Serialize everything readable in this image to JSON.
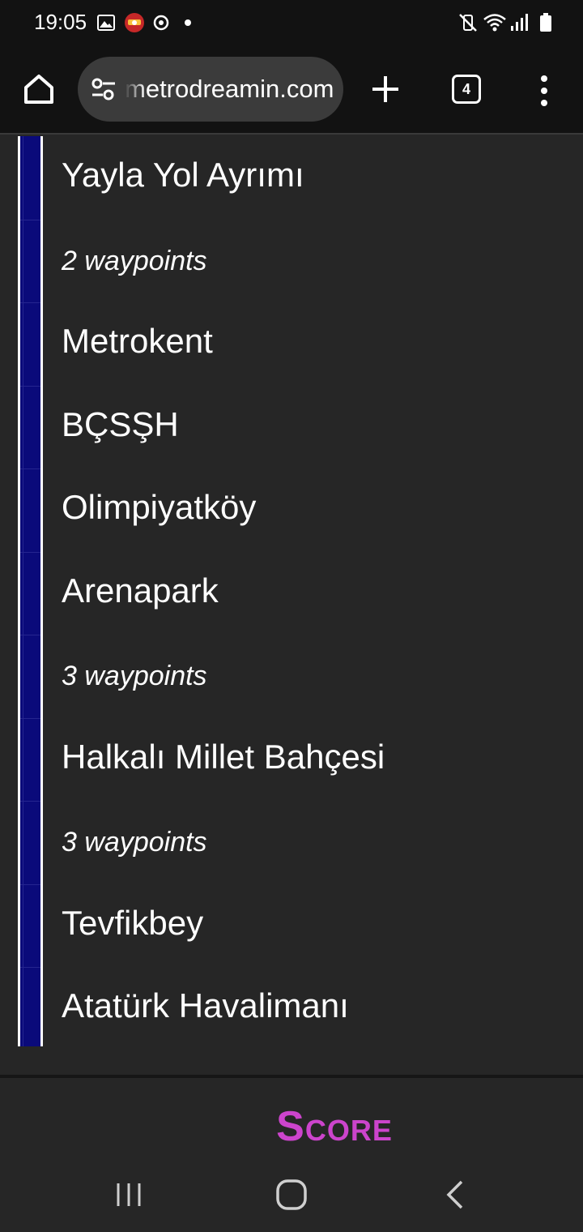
{
  "status_bar": {
    "time": "19:05",
    "left_icons": [
      "image-icon",
      "app-badge-icon",
      "sync-icon",
      "dot-icon"
    ],
    "right_icons": [
      "mute-vibrate-icon",
      "wifi-icon",
      "signal-icon",
      "battery-icon"
    ]
  },
  "browser": {
    "url": "metrodreamin.com",
    "tab_count": "4",
    "icons": [
      "home-icon",
      "site-settings-icon",
      "plus-icon",
      "more-vert-icon"
    ]
  },
  "line": {
    "color": "#0a0a7a",
    "stops": [
      {
        "label": "Yayla Yol Ayrımı",
        "waypoint": false
      },
      {
        "label": "2 waypoints",
        "waypoint": true
      },
      {
        "label": "Metrokent",
        "waypoint": false
      },
      {
        "label": "BÇSŞH",
        "waypoint": false
      },
      {
        "label": "Olimpiyatköy",
        "waypoint": false
      },
      {
        "label": "Arenapark",
        "waypoint": false
      },
      {
        "label": "3 waypoints",
        "waypoint": true
      },
      {
        "label": "Halkalı Millet Bahçesi",
        "waypoint": false
      },
      {
        "label": "3 waypoints",
        "waypoint": true
      },
      {
        "label": "Tevfikbey",
        "waypoint": false
      },
      {
        "label": "Atatürk Havalimanı",
        "waypoint": false
      }
    ]
  },
  "score": {
    "label": "Score",
    "color": "#cc44cc"
  },
  "nav_bar": {
    "icons": [
      "recent-apps-icon",
      "home-button-icon",
      "back-icon"
    ]
  }
}
